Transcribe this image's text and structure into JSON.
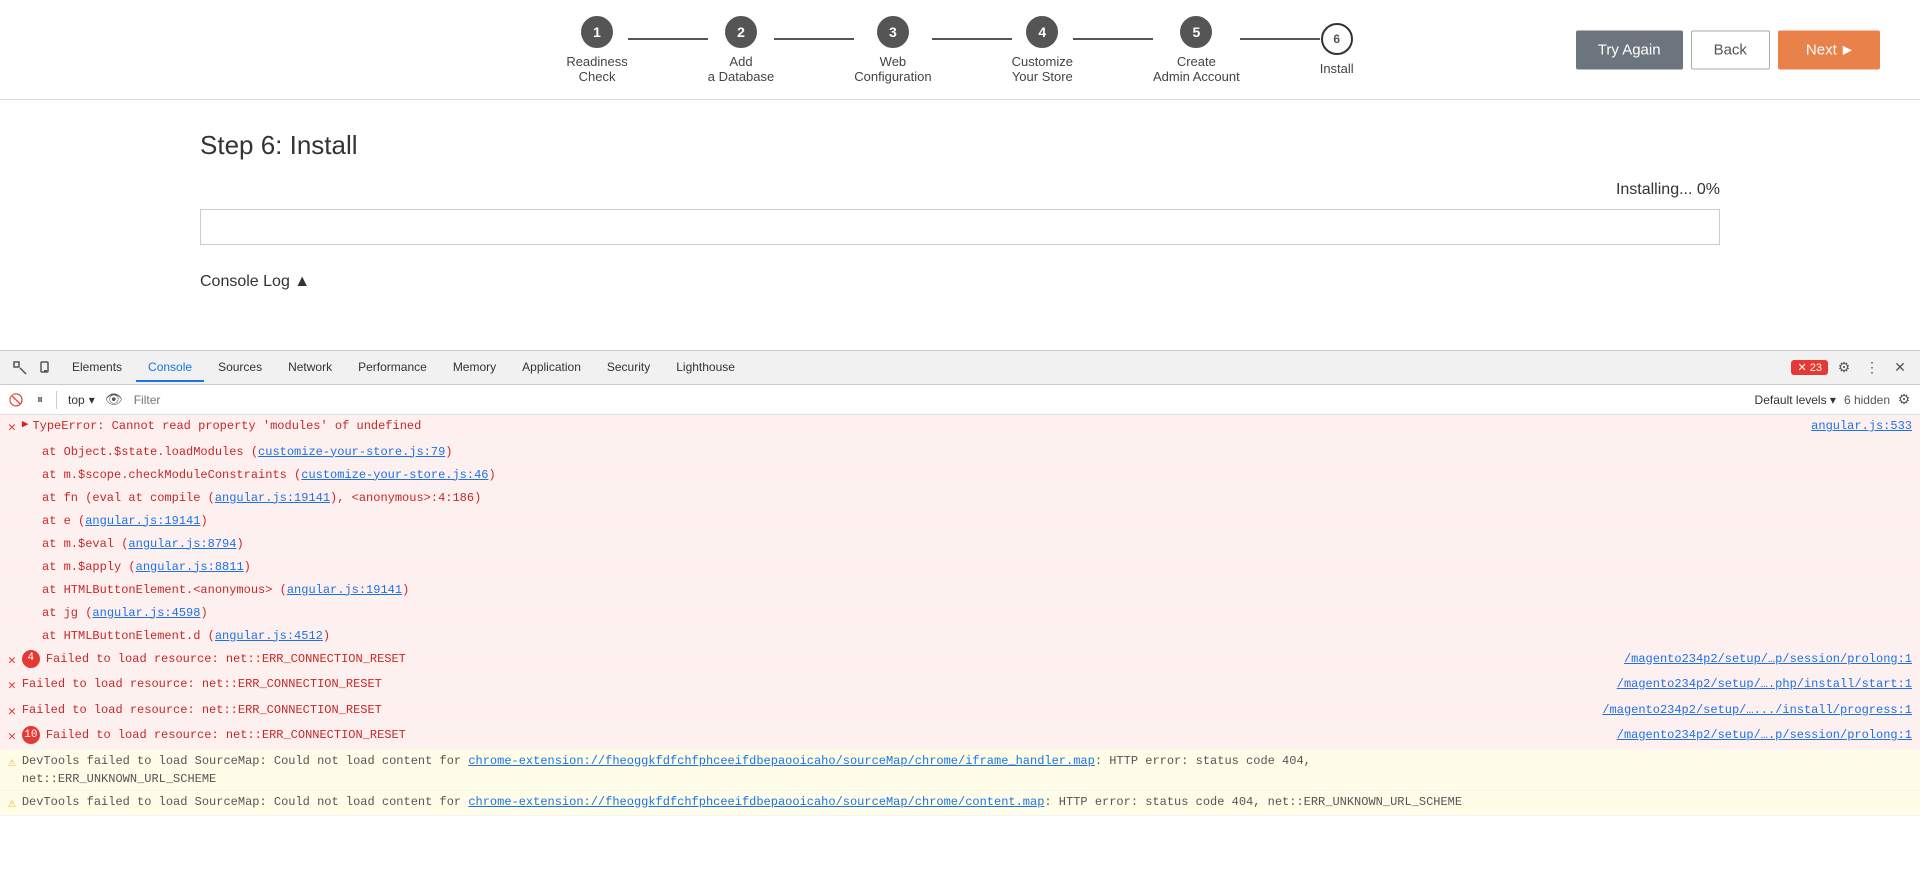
{
  "wizard": {
    "steps": [
      {
        "number": "1",
        "label": "Readiness\nCheck",
        "state": "completed"
      },
      {
        "number": "2",
        "label": "Add\na Database",
        "state": "completed"
      },
      {
        "number": "3",
        "label": "Web\nConfiguration",
        "state": "completed"
      },
      {
        "number": "4",
        "label": "Customize\nYour Store",
        "state": "completed"
      },
      {
        "number": "5",
        "label": "Create\nAdmin Account",
        "state": "completed"
      },
      {
        "number": "6",
        "label": "Install",
        "state": "current"
      }
    ],
    "buttons": {
      "try_again": "Try Again",
      "back": "Back",
      "next": "Next"
    }
  },
  "main": {
    "step_title": "Step 6: Install",
    "installing_status": "Installing... 0%",
    "progress_percent": 0,
    "console_log_header": "Console Log ▲"
  },
  "devtools": {
    "tabs": [
      {
        "label": "Elements",
        "active": false
      },
      {
        "label": "Console",
        "active": true
      },
      {
        "label": "Sources",
        "active": false
      },
      {
        "label": "Network",
        "active": false
      },
      {
        "label": "Performance",
        "active": false
      },
      {
        "label": "Memory",
        "active": false
      },
      {
        "label": "Application",
        "active": false
      },
      {
        "label": "Security",
        "active": false
      },
      {
        "label": "Lighthouse",
        "active": false
      }
    ],
    "error_count": "✕ 23",
    "toolbar": {
      "context": "top",
      "filter_placeholder": "Filter",
      "log_level": "Default levels ▾",
      "hidden_count": "6 hidden"
    },
    "console_lines": [
      {
        "type": "error-expandable",
        "badge": null,
        "expand": "▶",
        "main": "TypeError: Cannot read property 'modules' of undefined",
        "file": "angular.js:533"
      },
      {
        "type": "error-indent",
        "text": "at Object.$state.loadModules (customize-your-store.js:79)"
      },
      {
        "type": "error-indent",
        "text": "at m.$scope.checkModuleConstraints (customize-your-store.js:46)"
      },
      {
        "type": "error-indent",
        "text": "at fn (eval at compile (angular.js:19141), <anonymous>:4:186)"
      },
      {
        "type": "error-indent",
        "text": "at e (angular.js:19141)"
      },
      {
        "type": "error-indent",
        "text": "at m.$eval (angular.js:8794)"
      },
      {
        "type": "error-indent",
        "text": "at m.$apply (angular.js:8811)"
      },
      {
        "type": "error-indent",
        "text": "at HTMLButtonElement.<anonymous> (angular.js:19141)"
      },
      {
        "type": "error-indent",
        "text": "at jg (angular.js:4598)"
      },
      {
        "type": "error-indent",
        "text": "at HTMLButtonElement.d (angular.js:4512)"
      },
      {
        "type": "error-resource",
        "badge": "4",
        "main": "Failed to load resource: net::ERR_CONNECTION_RESET",
        "file": "/magento234p2/setup/…p/session/prolong:1"
      },
      {
        "type": "error-resource",
        "badge": null,
        "main": "Failed to load resource: net::ERR_CONNECTION_RESET",
        "file": "/magento234p2/setup/….php/install/start:1"
      },
      {
        "type": "error-resource",
        "badge": null,
        "main": "Failed to load resource: net::ERR_CONNECTION_RESET",
        "file": "/magento234p2/setup/….../install/progress:1"
      },
      {
        "type": "error-resource",
        "badge": "10",
        "main": "Failed to load resource: net::ERR_CONNECTION_RESET",
        "file": "/magento234p2/setup/….p/session/prolong:1"
      },
      {
        "type": "warning",
        "main": "DevTools failed to load SourceMap: Could not load content for chrome-extension://fheoggkfdfchfphceeifdbepaooi caho/sourceMap/chrome/iframe_handler.map: HTTP error: status code 404,\nnet::ERR_UNKNOWN_URL_SCHEME"
      },
      {
        "type": "warning",
        "main": "DevTools failed to load SourceMap: Could not load content for chrome-extension://fheoggkfdfchfphceeifdbepaooi caho/sourceMap/chrome/content.map: HTTP error: status code 404, net::ERR_UNKNOWN_URL_SCHEME"
      }
    ]
  }
}
